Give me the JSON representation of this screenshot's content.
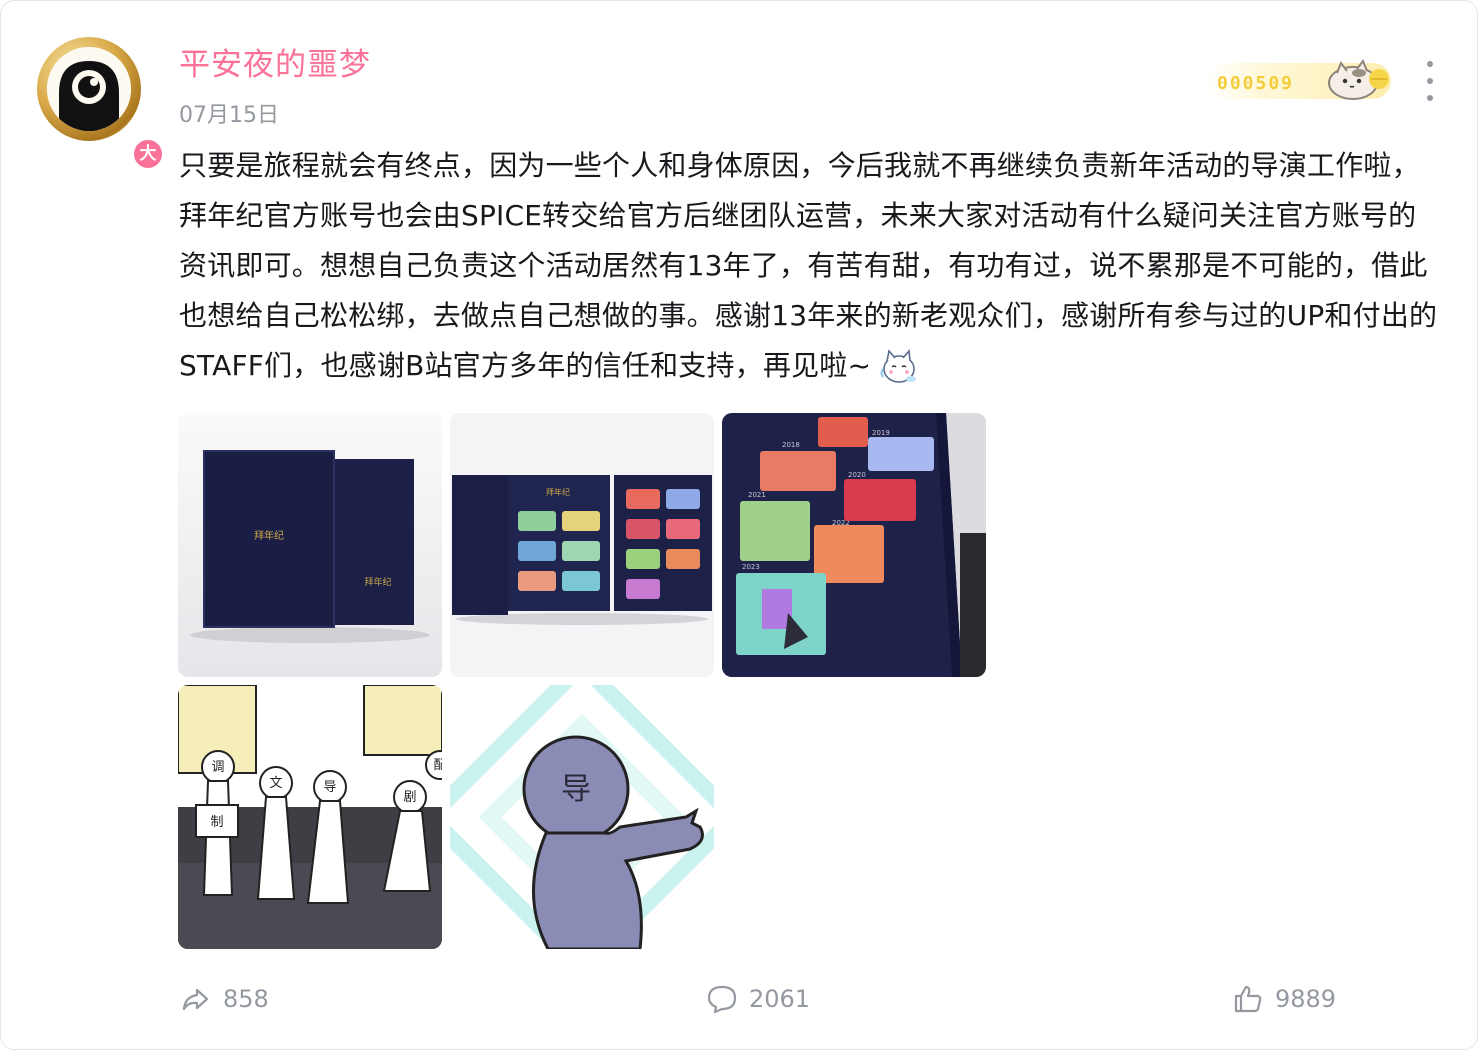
{
  "post": {
    "author": {
      "name": "平安夜的噩梦",
      "badge": "大"
    },
    "date": "07月15日",
    "fan_badge": {
      "number": "000509"
    },
    "text": "只要是旅程就会有终点，因为一些个人和身体原因，今后我就不再继续负责新年活动的导演工作啦，拜年纪官方账号也会由SPICE转交给官方后继团队运营，未来大家对活动有什么疑问关注官方账号的资讯即可。想想自己负责这个活动居然有13年了，有苦有甜，有功有过，说不累那是不可能的，借此也想给自己松松绑，去做点自己想做的事。感谢13年来的新老观众们，感谢所有参与过的UP和付出的STAFF们，也感谢B站官方多年的信任和支持，再见啦~",
    "images": {
      "img1": {
        "logo_text": "拜年纪"
      },
      "img2": {
        "logo_text": "拜年纪"
      },
      "img3": {
        "years": [
          "2018",
          "2019",
          "2020",
          "2021",
          "2022",
          "2023"
        ]
      },
      "img4": {
        "chars": [
          "调",
          "文",
          "导",
          "剧",
          "制",
          "配"
        ]
      },
      "img5": {
        "char": "导"
      }
    },
    "stats": {
      "shares": "858",
      "comments": "2061",
      "likes": "9889"
    }
  },
  "colors": {
    "username": "#fb7299",
    "muted": "#9499a0",
    "fan_gold": "#f3cd3b"
  }
}
